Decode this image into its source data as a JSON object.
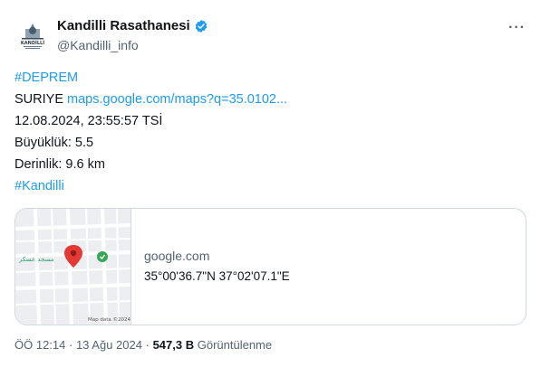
{
  "tweet": {
    "author": {
      "display_name": "Kandilli Rasathanesi",
      "handle": "@Kandilli_info",
      "verified": true,
      "avatar_text": "KANDİLLİ"
    },
    "more_label": "···",
    "lines": {
      "hashtag1": "#DEPREM",
      "location": "SURIYE",
      "map_link": "maps.google.com/maps?q=35.0102...",
      "datetime": "12.08.2024, 23:55:57 TSİ",
      "magnitude": "Büyüklük: 5.5",
      "depth": "Derinlik: 9.6 km",
      "hashtag2": "#Kandilli"
    },
    "card": {
      "domain": "google.com",
      "coords": "35°00'36.7\"N 37°02'07.1\"E",
      "map_label": "مسجد عسكر",
      "map_credit": "Map data ©2024"
    },
    "meta": {
      "time": "ÖÖ 12:14",
      "date": "13 Ağu 2024",
      "views": "547,3 B",
      "views_label": "Görüntülenme"
    }
  },
  "colors": {
    "link": "#1d9bf0",
    "verified": "#1d9bf0",
    "secondary_text": "#536471",
    "pin": "#e53935"
  }
}
